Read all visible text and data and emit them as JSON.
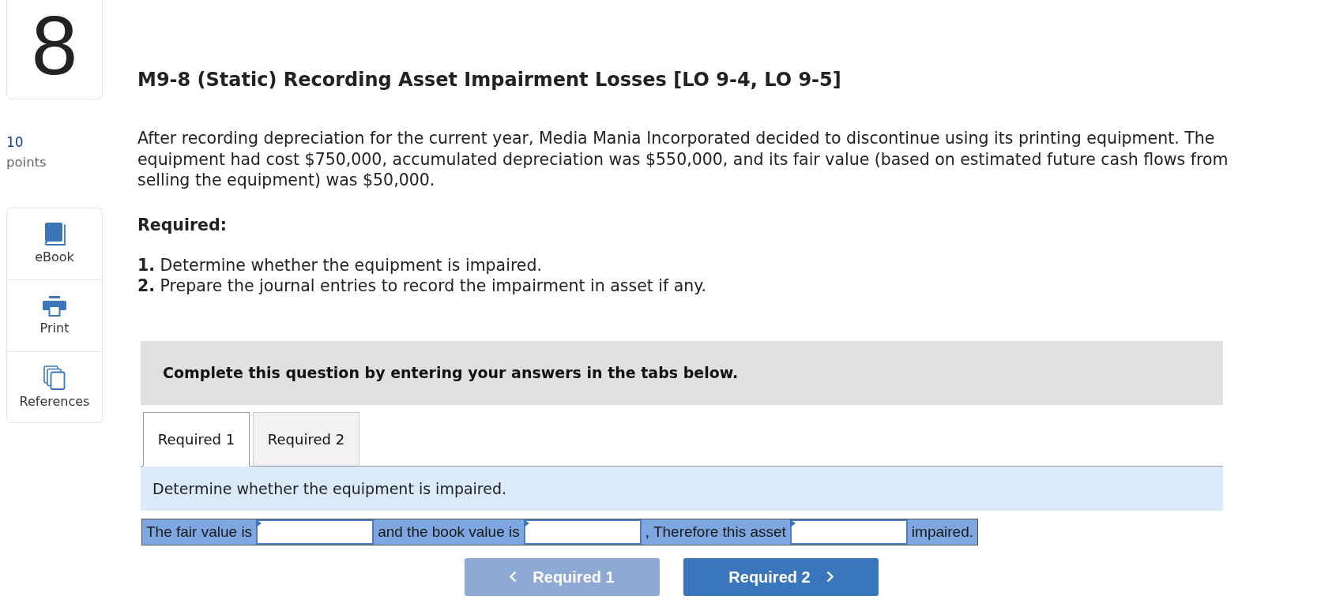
{
  "question": {
    "number": "8",
    "points": "10",
    "points_label": "points"
  },
  "tools": [
    {
      "kind": "book",
      "label": "eBook"
    },
    {
      "kind": "printer",
      "label": "Print"
    },
    {
      "kind": "references",
      "label": "References"
    }
  ],
  "title": "M9-8 (Static) Recording Asset Impairment Losses [LO 9-4, LO 9-5]",
  "problem": "After recording depreciation for the current year, Media Mania Incorporated decided to discontinue using its printing equipment. The equipment had cost $750,000, accumulated depreciation was $550,000, and its fair value (based on estimated future cash flows from selling the equipment) was $50,000.",
  "required_heading": "Required:",
  "requirements": [
    "**1.** Determine whether the equipment is impaired.",
    "**2.** Prepare the journal entries to record the impairment in asset if any."
  ],
  "instructions": "Complete this question by entering your answers in the tabs below.",
  "tabs": [
    {
      "label": "Required 1",
      "selected": true
    },
    {
      "label": "Required 2",
      "selected": false
    }
  ],
  "tab_prompt": "Determine whether the equipment is impaired.",
  "answer_row": [
    {
      "kind": "text",
      "text": "The fair value is"
    },
    {
      "kind": "input"
    },
    {
      "kind": "text",
      "text": "and the book value is"
    },
    {
      "kind": "input"
    },
    {
      "kind": "text",
      "text": ", Therefore this asset"
    },
    {
      "kind": "input"
    },
    {
      "kind": "text",
      "text": "impaired."
    }
  ],
  "nav_buttons": [
    {
      "kind": "previous",
      "label": "Required 1",
      "disabled": true
    },
    {
      "kind": "next",
      "label": "Required 2",
      "disabled": false
    }
  ]
}
